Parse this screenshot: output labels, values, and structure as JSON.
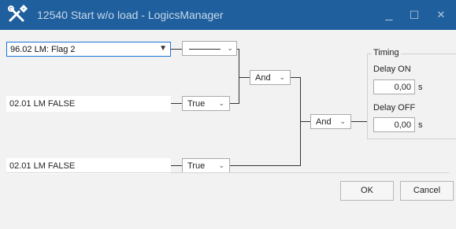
{
  "window": {
    "title": "12540 Start w/o load - LogicsManager",
    "minimize": "_",
    "maximize": "☐",
    "close": "✕"
  },
  "inputs": {
    "input1": {
      "value": "96.02 LM: Flag 2",
      "sign": "———"
    },
    "input2": {
      "value": "02.01 LM FALSE",
      "sign": "True"
    },
    "input3": {
      "value": "02.01 LM FALSE",
      "sign": "True"
    }
  },
  "operators": {
    "op1": "And",
    "op2": "And"
  },
  "timing": {
    "title": "Timing",
    "delay_on_label": "Delay ON",
    "delay_on_value": "0,00",
    "delay_on_unit": "s",
    "delay_off_label": "Delay OFF",
    "delay_off_value": "0,00",
    "delay_off_unit": "s"
  },
  "buttons": {
    "ok": "OK",
    "cancel": "Cancel"
  },
  "icons": {
    "app": "tools-icon",
    "dropdown": "chevron-down-icon"
  }
}
